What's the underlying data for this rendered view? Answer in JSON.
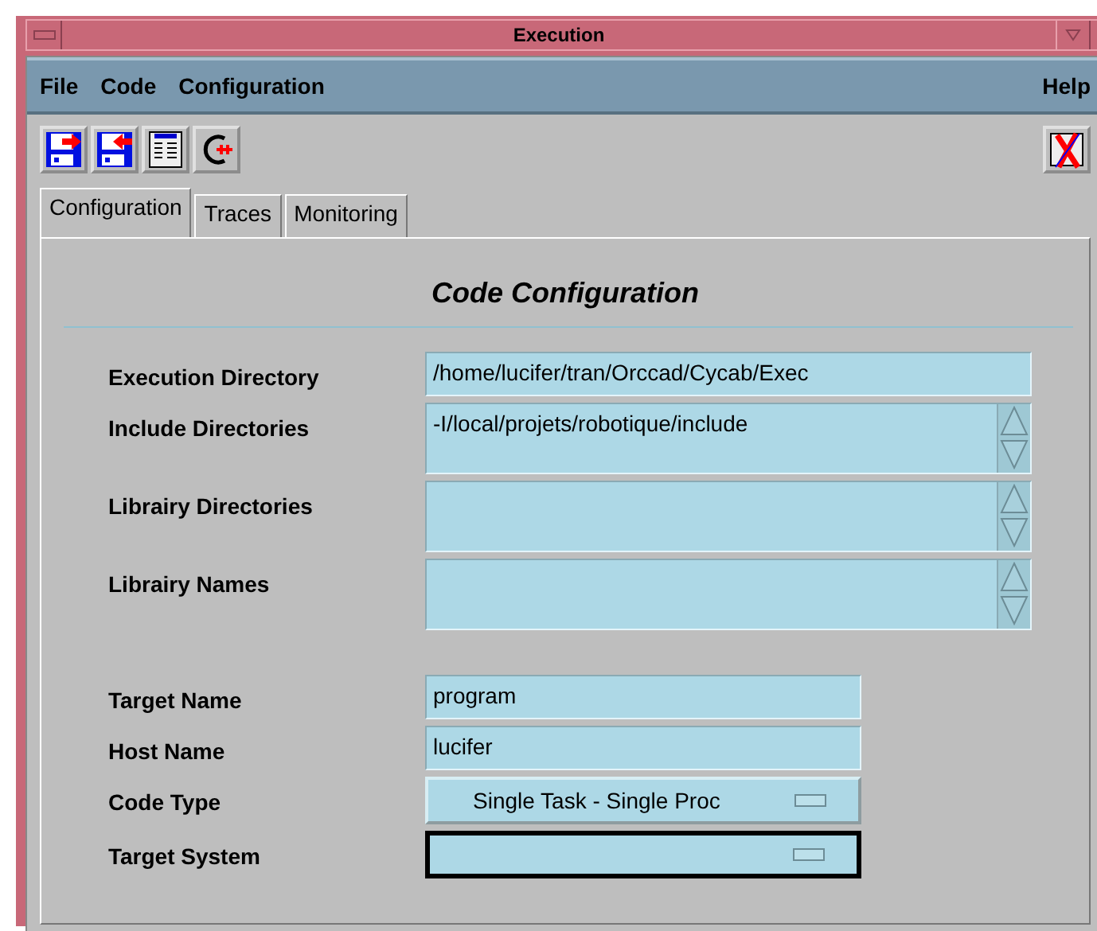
{
  "window": {
    "title": "Execution"
  },
  "menu": [
    {
      "label": "File"
    },
    {
      "label": "Code"
    },
    {
      "label": "Configuration"
    }
  ],
  "help_menu": {
    "label": "Help"
  },
  "tabs": [
    {
      "label": "Configuration",
      "selected": true
    },
    {
      "label": "Traces",
      "selected": false
    },
    {
      "label": "Monitoring",
      "selected": false
    }
  ],
  "section_title": "Code Configuration",
  "field_groups": [
    [
      {
        "label": "Execution Directory",
        "kind": "text",
        "value": "/home/lucifer/tran/Orccad/Cycab/Exec",
        "focused": false
      },
      {
        "label": "Include Directories",
        "kind": "list",
        "value": "-I/local/projets/robotique/include",
        "focused": false
      },
      {
        "label": "Librairy Directories",
        "kind": "list",
        "focused": false
      },
      {
        "label": "Librairy Names",
        "kind": "list",
        "focused": false
      }
    ],
    [
      {
        "label": "Target Name",
        "kind": "short",
        "value": "program",
        "focused": false
      },
      {
        "label": "Host Name",
        "kind": "short",
        "value": "lucifer",
        "focused": false
      },
      {
        "label": "Code Type",
        "kind": "option",
        "value": "Single Task - Single Proc",
        "focused": false
      },
      {
        "label": "Target System",
        "kind": "option",
        "focused": true
      }
    ]
  ]
}
